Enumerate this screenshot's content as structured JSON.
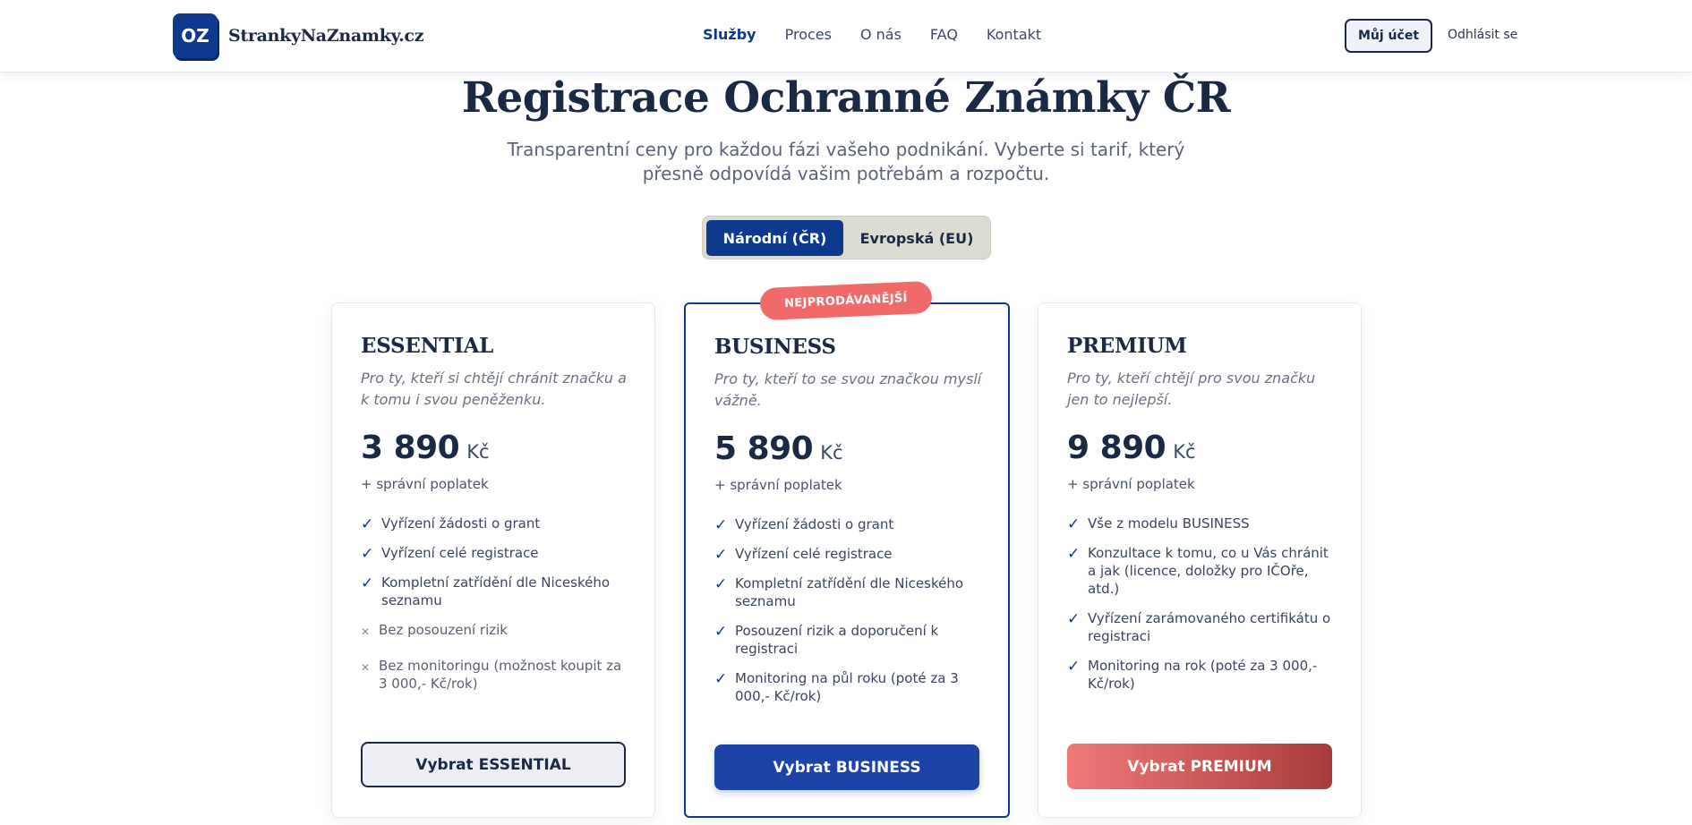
{
  "brand": {
    "mark": "OZ",
    "name": "StrankyNaZnamky.cz"
  },
  "nav": [
    {
      "label": "Služby",
      "active": true
    },
    {
      "label": "Proces",
      "active": false
    },
    {
      "label": "O nás",
      "active": false
    },
    {
      "label": "FAQ",
      "active": false
    },
    {
      "label": "Kontakt",
      "active": false
    }
  ],
  "header_actions": {
    "account": "Můj účet",
    "logout": "Odhlásit se"
  },
  "hero": {
    "title": "Registrace Ochranné Známky ČR",
    "subtitle": "Transparentní ceny pro každou fázi vašeho podnikání. Vyberte si tarif, který přesně odpovídá vašim potřebám a rozpočtu."
  },
  "toggle": {
    "selected": "Národní (ČR)",
    "other": "Evropská (EU)"
  },
  "badge": "NEJPRODÁVANĚJŠÍ",
  "colors": {
    "primary": "#0d3a8c",
    "accent": "#f06a6a",
    "premium_end": "#a83c3c"
  },
  "plans": [
    {
      "name": "ESSENTIAL",
      "tagline": "Pro ty, kteří si chtějí chránit značku a k tomu i svou peněženku.",
      "price": "3 890",
      "currency": "Kč",
      "fee": "+ správní poplatek",
      "features": [
        {
          "text": "Vyřízení žádosti o grant",
          "included": true
        },
        {
          "text": "Vyřízení celé registrace",
          "included": true
        },
        {
          "text": "Kompletní zatřídění dle Niceského seznamu",
          "included": true
        },
        {
          "text": "Bez posouzení rizik",
          "included": false
        },
        {
          "text": "Bez monitoringu (možnost koupit za 3 000,- Kč/rok)",
          "included": false
        }
      ],
      "cta": "Vybrat ESSENTIAL"
    },
    {
      "name": "BUSINESS",
      "tagline": "Pro ty, kteří to se svou značkou myslí vážně.",
      "price": "5 890",
      "currency": "Kč",
      "fee": "+ správní poplatek",
      "features": [
        {
          "text": "Vyřízení žádosti o grant",
          "included": true
        },
        {
          "text": "Vyřízení celé registrace",
          "included": true
        },
        {
          "text": "Kompletní zatřídění dle Niceského seznamu",
          "included": true
        },
        {
          "text": "Posouzení rizik a doporučení k registraci",
          "included": true
        },
        {
          "text": "Monitoring na půl roku (poté za 3 000,- Kč/rok)",
          "included": true
        }
      ],
      "cta": "Vybrat BUSINESS"
    },
    {
      "name": "PREMIUM",
      "tagline": "Pro ty, kteří chtějí pro svou značku jen to nejlepší.",
      "price": "9 890",
      "currency": "Kč",
      "fee": "+ správní poplatek",
      "features": [
        {
          "text": "Vše z modelu BUSINESS",
          "included": true
        },
        {
          "text": "Konzultace k tomu, co u Vás chránit a jak (licence, doložky pro IČOře, atd.)",
          "included": true
        },
        {
          "text": "Vyřízení zarámovaného certifikátu o registraci",
          "included": true
        },
        {
          "text": "Monitoring na rok (poté za 3 000,- Kč/rok)",
          "included": true
        }
      ],
      "cta": "Vybrat PREMIUM"
    }
  ]
}
